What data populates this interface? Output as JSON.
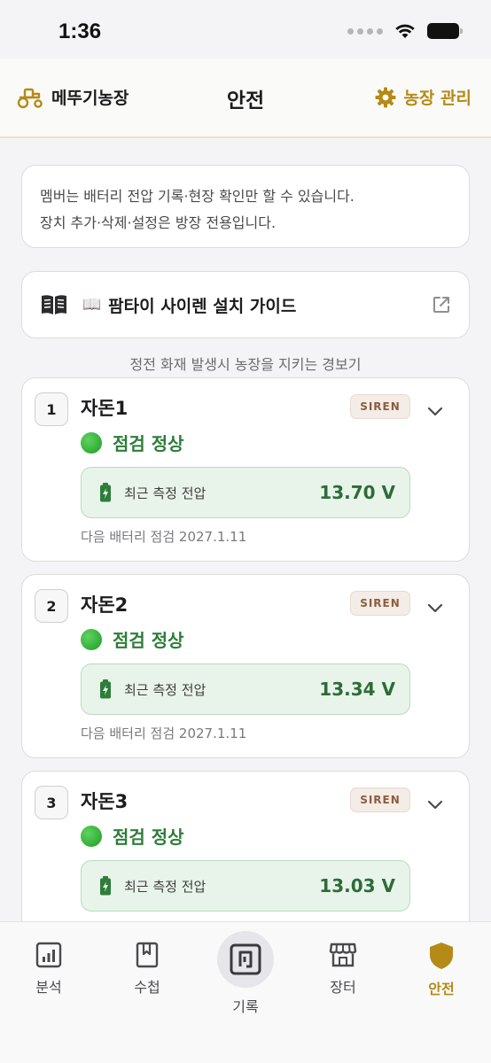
{
  "status_bar": {
    "time": "1:36"
  },
  "header": {
    "farm_name": "메뚜기농장",
    "title": "안전",
    "manage_label": "농장 관리"
  },
  "notice": {
    "line1": "멤버는 배터리 전압 기록·현장 확인만 할 수 있습니다.",
    "line2": "장치 추가·삭제·설정은 방장 전용입니다."
  },
  "guide": {
    "emoji": "📖",
    "label": "팜타이 사이렌 설치 가이드"
  },
  "caption": "정전 화재 발생시 농장을 지키는 경보기",
  "devices": [
    {
      "index": "1",
      "name": "자돈1",
      "badge": "SIREN",
      "status": "점검 정상",
      "voltage_label": "최근 측정 전압",
      "voltage": "13.70 V",
      "next_check": "다음 배터리 점검 2027.1.11"
    },
    {
      "index": "2",
      "name": "자돈2",
      "badge": "SIREN",
      "status": "점검 정상",
      "voltage_label": "최근 측정 전압",
      "voltage": "13.34 V",
      "next_check": "다음 배터리 점검 2027.1.11"
    },
    {
      "index": "3",
      "name": "자돈3",
      "badge": "SIREN",
      "status": "점검 정상",
      "voltage_label": "최근 측정 전압",
      "voltage": "13.03 V",
      "next_check": ""
    }
  ],
  "tabs": [
    {
      "label": "분석",
      "icon": "chart-icon"
    },
    {
      "label": "수첩",
      "icon": "bookmark-icon"
    },
    {
      "label": "기록",
      "icon": "nfc-icon"
    },
    {
      "label": "장터",
      "icon": "store-icon"
    },
    {
      "label": "안전",
      "icon": "shield-icon",
      "active": true
    }
  ],
  "colors": {
    "accent": "#b58a16",
    "status_green": "#2e7d3a",
    "voltage_bg": "#e8f4ea"
  }
}
